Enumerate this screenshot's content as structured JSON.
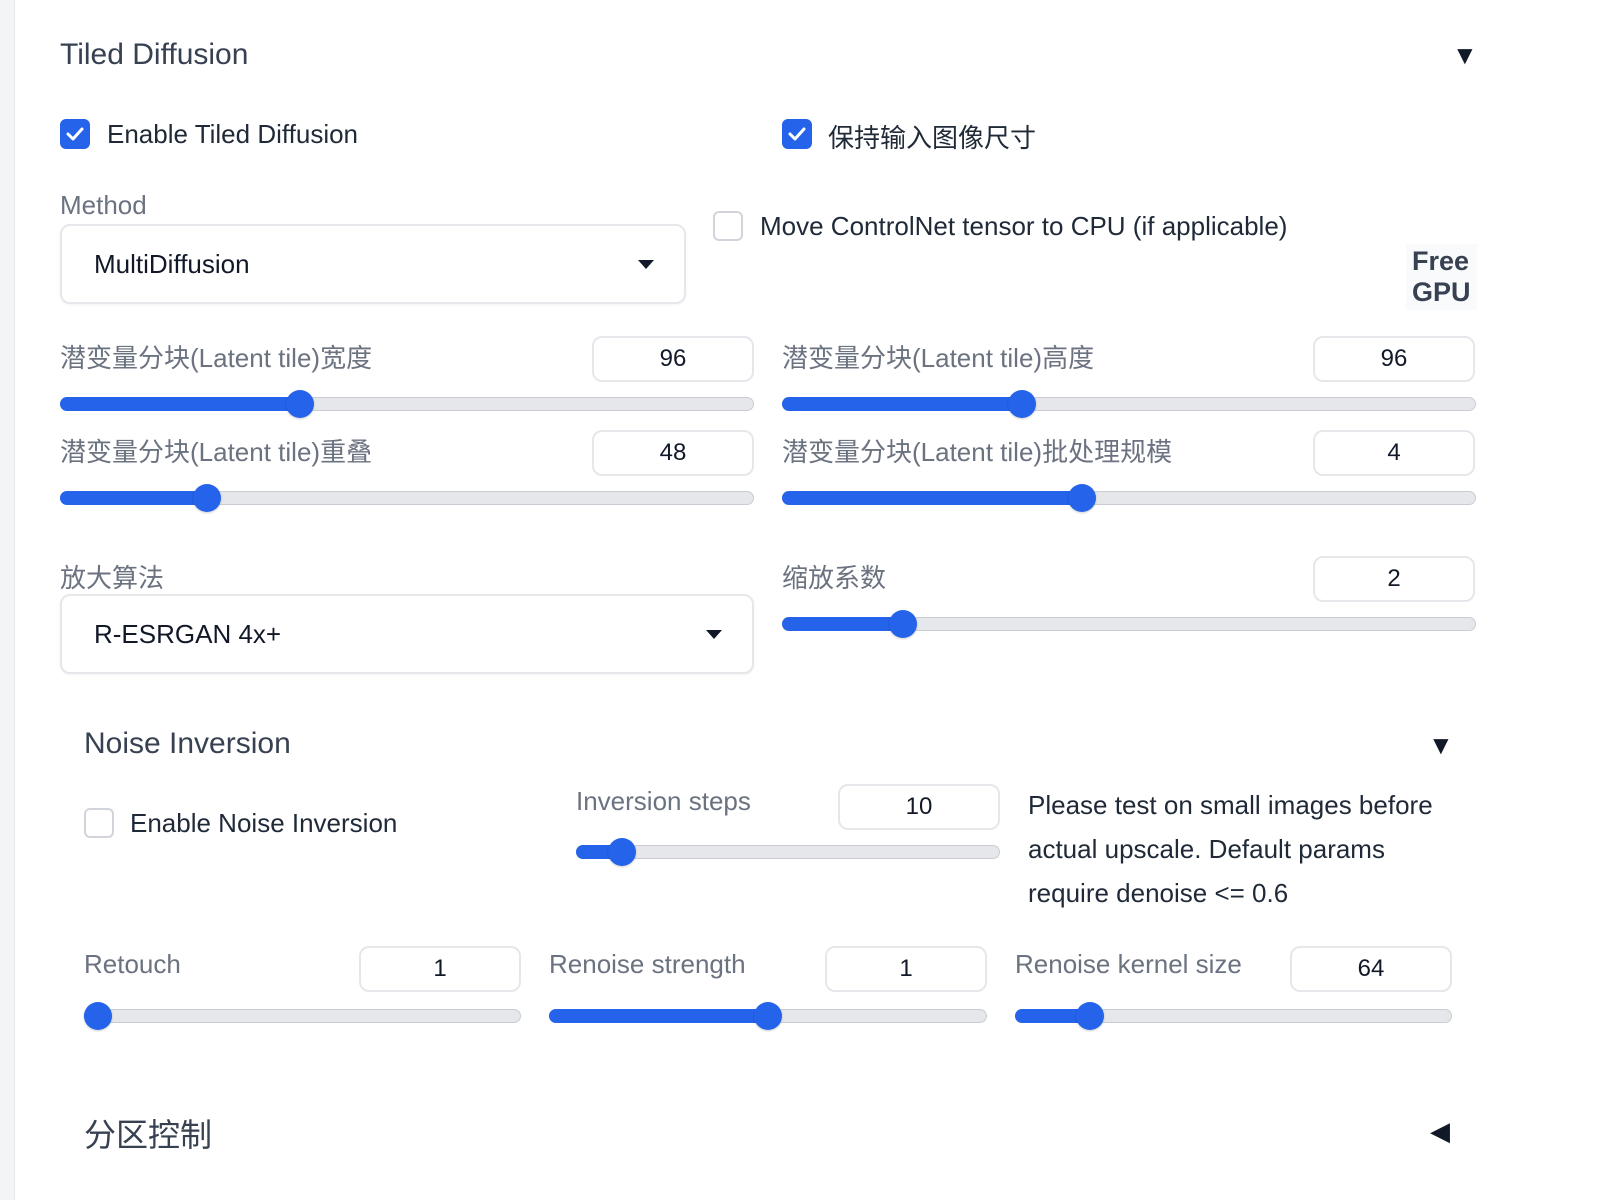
{
  "tiled_diffusion": {
    "title": "Tiled Diffusion",
    "arrow": "▼",
    "enable_label": "Enable Tiled Diffusion",
    "keep_size_label": "保持输入图像尺寸",
    "method_label": "Method",
    "method_value": "MultiDiffusion",
    "move_controlnet_label": "Move ControlNet tensor to CPU (if applicable)",
    "free_gpu_line1": "Free",
    "free_gpu_line2": "GPU",
    "sliders": {
      "tile_width": {
        "label": "潜变量分块(Latent tile)宽度",
        "value": "96",
        "fraction": 0.34
      },
      "tile_height": {
        "label": "潜变量分块(Latent tile)高度",
        "value": "96",
        "fraction": 0.34
      },
      "tile_overlap": {
        "label": "潜变量分块(Latent tile)重叠",
        "value": "48",
        "fraction": 0.2
      },
      "tile_batch": {
        "label": "潜变量分块(Latent tile)批处理规模",
        "value": "4",
        "fraction": 0.43
      },
      "scale_factor": {
        "label": "缩放系数",
        "value": "2",
        "fraction": 0.16
      }
    },
    "upscaler_label": "放大算法",
    "upscaler_value": "R-ESRGAN 4x+"
  },
  "noise_inversion": {
    "title": "Noise Inversion",
    "arrow": "▼",
    "enable_label": "Enable Noise Inversion",
    "note_line1": "Please test on small images before",
    "note_line2": "actual upscale. Default params",
    "note_line3": "require denoise <= 0.6",
    "sliders": {
      "inversion_steps": {
        "label": "Inversion steps",
        "value": "10",
        "fraction": 0.08
      },
      "retouch": {
        "label": "Retouch",
        "value": "1",
        "fraction": 0.0
      },
      "renoise_strength": {
        "label": "Renoise strength",
        "value": "1",
        "fraction": 0.5
      },
      "renoise_kernel": {
        "label": "Renoise kernel size",
        "value": "64",
        "fraction": 0.15
      }
    }
  },
  "region_control": {
    "title": "分区控制",
    "arrow": "◀"
  },
  "colors": {
    "accent": "#2563eb",
    "track": "#e5e7eb"
  }
}
